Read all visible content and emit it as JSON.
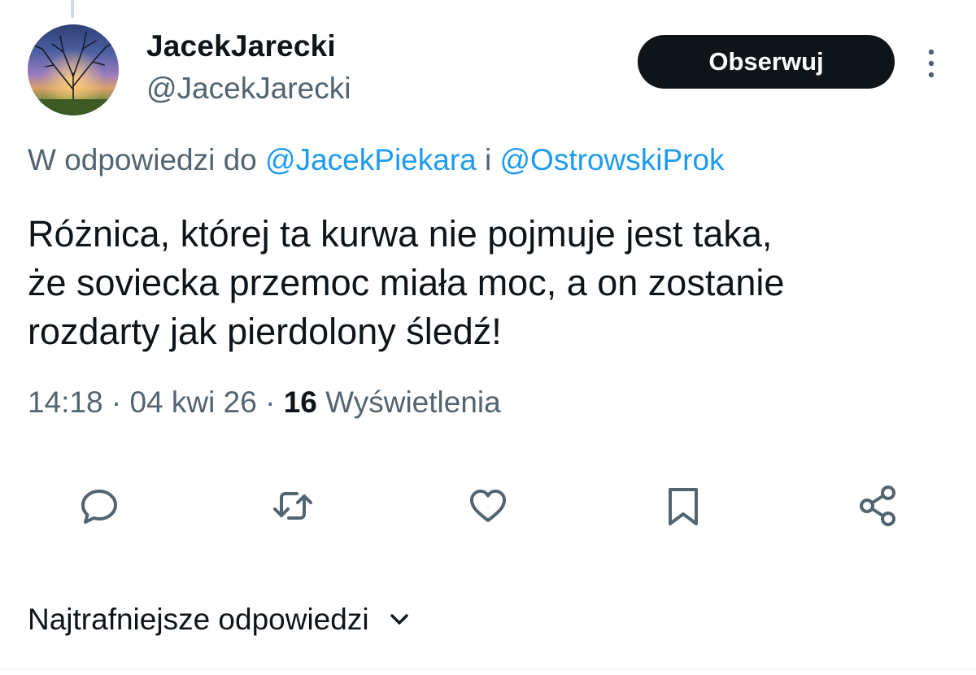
{
  "author": {
    "display_name": "JacekJarecki",
    "handle": "@JacekJarecki"
  },
  "follow_button": {
    "label": "Obserwuj"
  },
  "reply_context": {
    "prefix": "W odpowiedzi do ",
    "mention_1": "@JacekPiekara",
    "joiner": " i ",
    "mention_2": "@OstrowskiProk"
  },
  "tweet": {
    "lines": [
      "Różnica, której ta kurwa nie pojmuje jest taka,",
      "że soviecka przemoc miała moc, a on zostanie",
      "rozdarty jak pierdolony śledź!"
    ]
  },
  "meta": {
    "time": "14:18",
    "separator": " · ",
    "date": "04 kwi 26",
    "views_count": "16",
    "views_label": " Wyświetlenia"
  },
  "actions": [
    {
      "icon": "reply-icon"
    },
    {
      "icon": "retweet-icon"
    },
    {
      "icon": "like-icon"
    },
    {
      "icon": "bookmark-icon"
    },
    {
      "icon": "share-icon"
    }
  ],
  "sort": {
    "label": "Najtrafniejsze odpowiedzi",
    "icon": "chevron-down-icon"
  },
  "colors": {
    "text": "#0f1419",
    "secondary": "#536471",
    "link": "#1d9bf0",
    "button_bg": "#0f1419",
    "button_text": "#ffffff"
  }
}
